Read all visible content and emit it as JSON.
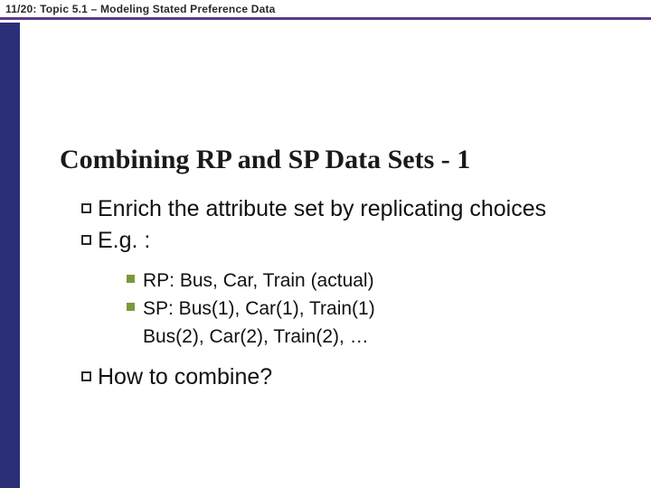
{
  "header": {
    "text": "11/20: Topic 5.1 – Modeling Stated Preference Data"
  },
  "slide": {
    "title": "Combining RP and SP Data Sets - 1",
    "bullets_l1": [
      "Enrich the attribute set by replicating choices",
      "E.g. :"
    ],
    "bullets_l2": [
      {
        "line": "RP: Bus, Car, Train  (actual)"
      },
      {
        "line": "SP: Bus(1), Car(1), Train(1)",
        "cont": "Bus(2), Car(2), Train(2), …"
      }
    ],
    "bullets_l1_after": [
      "How to combine?"
    ]
  }
}
